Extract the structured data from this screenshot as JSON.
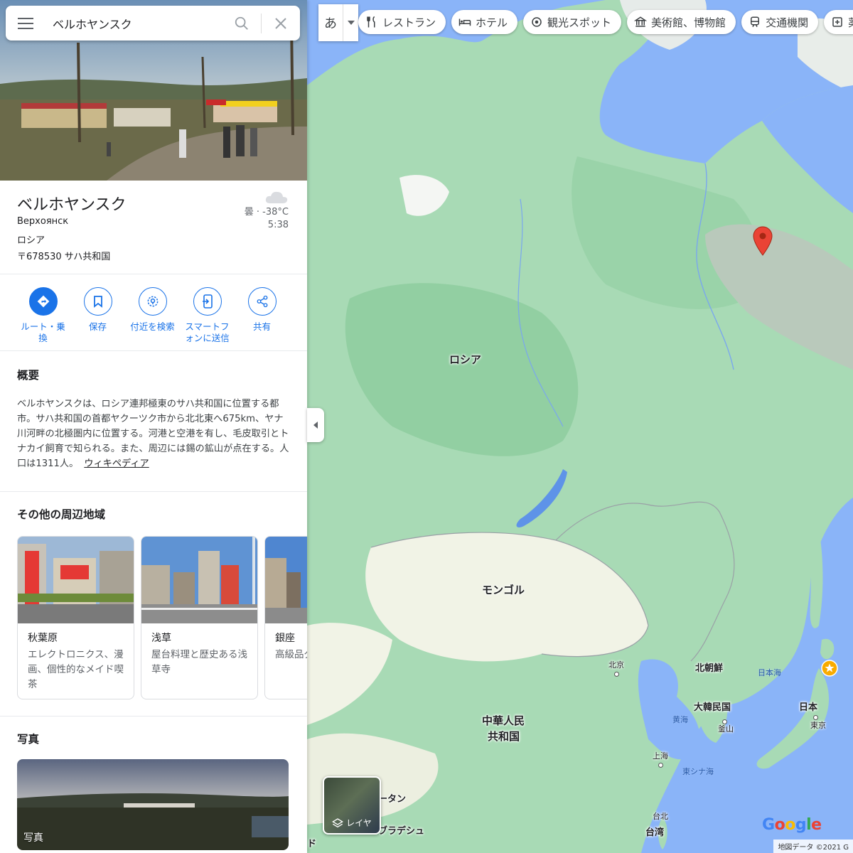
{
  "search": {
    "value": "ベルホヤンスク"
  },
  "place": {
    "title": "ベルホヤンスク",
    "native_name": "Верхоянск",
    "country": "ロシア",
    "postal": "〒678530 サハ共和国",
    "weather": "曇 · -38°C",
    "local_time": "5:38"
  },
  "actions": [
    {
      "label": "ルート・乗換",
      "icon": "directions-icon"
    },
    {
      "label": "保存",
      "icon": "bookmark-icon"
    },
    {
      "label": "付近を検索",
      "icon": "nearby-search-icon"
    },
    {
      "label": "スマートフォンに送信",
      "icon": "send-to-phone-icon"
    },
    {
      "label": "共有",
      "icon": "share-icon"
    }
  ],
  "overview": {
    "title": "概要",
    "text": "ベルホヤンスクは、ロシア連邦極東のサハ共和国に位置する都市。サハ共和国の首都ヤクーツク市から北北東へ675km、ヤナ川河畔の北極圏内に位置する。河港と空港を有し、毛皮取引とトナカイ飼育で知られる。また、周辺には錫の鉱山が点在する。人口は1311人。",
    "link": "ウィキペディア"
  },
  "nearby": {
    "title": "その他の周辺地域",
    "cards": [
      {
        "title": "秋葉原",
        "desc": "エレクトロニクス、漫画、個性的なメイド喫茶"
      },
      {
        "title": "浅草",
        "desc": "屋台料理と歴史ある浅草寺"
      },
      {
        "title": "銀座",
        "desc": "高級品グと歌"
      }
    ]
  },
  "photos": {
    "title": "写真",
    "caption": "写真"
  },
  "top_bar": {
    "lang": "あ",
    "chips": [
      {
        "label": "レストラン",
        "icon": "fork-knife-icon"
      },
      {
        "label": "ホテル",
        "icon": "bed-icon"
      },
      {
        "label": "観光スポット",
        "icon": "attraction-icon"
      },
      {
        "label": "美術館、博物館",
        "icon": "museum-icon"
      },
      {
        "label": "交通機関",
        "icon": "train-icon"
      },
      {
        "label": "薬",
        "icon": "pharmacy-icon"
      }
    ]
  },
  "map": {
    "labels": {
      "russia": "ロシア",
      "mongolia": "モンゴル",
      "china_1": "中華人民",
      "china_2": "共和国",
      "north_korea": "北朝鮮",
      "south_korea": "大韓民国",
      "japan": "日本",
      "beijing": "北京",
      "seoul_busan": "釜山",
      "tokyo": "東京",
      "shanghai": "上海",
      "taipei": "台北",
      "taiwan": "台湾",
      "sea_japan": "日本海",
      "yellow_sea": "黄海",
      "east_china_sea": "東シナ海",
      "bhutan": "ータン",
      "bangladesh": "ブラデシュ",
      "india_partial": "ド"
    },
    "layers_label": "レイヤ",
    "google": "Google",
    "credit": "地図データ ©2021 G",
    "colors": {
      "forest": "#a8dab5",
      "water": "#8ab4f8",
      "desert": "#f1f3e6",
      "mountain": "#c7c9c4"
    }
  }
}
